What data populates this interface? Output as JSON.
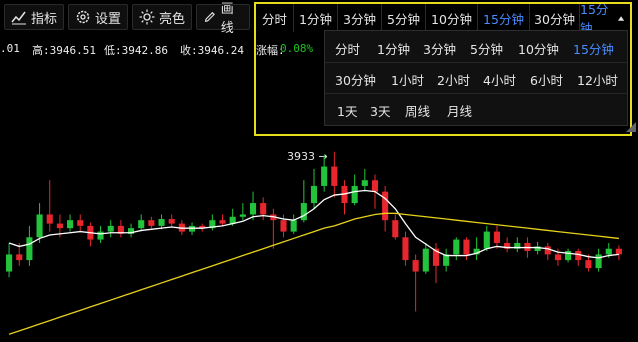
{
  "toolbar": {
    "buttons": [
      {
        "label": "指标",
        "icon": "chart-icon"
      },
      {
        "label": "设置",
        "icon": "gear-icon"
      },
      {
        "label": "亮色",
        "icon": "sun-icon"
      },
      {
        "label": "画线",
        "icon": "pencil-icon"
      }
    ]
  },
  "stats": {
    "prev_fragment": ".01",
    "high": "高:3946.51",
    "low": "低:3942.86",
    "close": "收:3946.24",
    "change_label": "涨幅:",
    "change_value": "0.08%"
  },
  "period_bar": {
    "tabs": [
      "分时",
      "1分钟",
      "3分钟",
      "5分钟",
      "10分钟",
      "15分钟",
      "30分钟"
    ],
    "active": "15分钟",
    "dropdown_label": "15分钟"
  },
  "period_panel": {
    "rows": [
      [
        "分时",
        "1分钟",
        "3分钟",
        "5分钟",
        "10分钟",
        "15分钟"
      ],
      [
        "30分钟",
        "1小时",
        "2小时",
        "4小时",
        "6小时",
        "12小时"
      ],
      [
        "1天",
        "3天",
        "周线",
        "月线"
      ]
    ],
    "active": "15分钟"
  },
  "chart": {
    "price_marker": "3933 →",
    "up_color": "#23c43c",
    "down_color": "#e8262e",
    "ma_fast_color": "#ffffff",
    "ma_slow_color": "#e6d21a"
  },
  "chart_data": {
    "type": "candlestick",
    "candles": [
      [
        3926,
        3927.5,
        3925.5,
        3928.5
      ],
      [
        3927.5,
        3927,
        3926.5,
        3928.5
      ],
      [
        3927,
        3929,
        3926.5,
        3930
      ],
      [
        3929,
        3931,
        3928.5,
        3932
      ],
      [
        3931,
        3930.2,
        3929.5,
        3934
      ],
      [
        3930.2,
        3929.8,
        3929,
        3931
      ],
      [
        3929.8,
        3930.5,
        3929.5,
        3931
      ],
      [
        3930.5,
        3930,
        3929.5,
        3931
      ],
      [
        3930,
        3928.8,
        3928.2,
        3930.3
      ],
      [
        3928.8,
        3929.5,
        3928.5,
        3930
      ],
      [
        3929.5,
        3930,
        3929,
        3930.5
      ],
      [
        3930,
        3929.3,
        3929,
        3930.5
      ],
      [
        3929.3,
        3929.8,
        3929,
        3930.2
      ],
      [
        3929.8,
        3930.5,
        3929.5,
        3931
      ],
      [
        3930.5,
        3930,
        3929.8,
        3930.8
      ],
      [
        3930,
        3930.6,
        3929.7,
        3931
      ],
      [
        3930.6,
        3930.2,
        3929.9,
        3931
      ],
      [
        3930.2,
        3929.5,
        3929.2,
        3930.5
      ],
      [
        3929.5,
        3930,
        3929.2,
        3930.3
      ],
      [
        3930,
        3929.8,
        3929.5,
        3930.2
      ],
      [
        3929.8,
        3930.5,
        3929.6,
        3931
      ],
      [
        3930.5,
        3930.2,
        3930,
        3931
      ],
      [
        3930.2,
        3930.8,
        3930,
        3931.5
      ],
      [
        3930.8,
        3931,
        3930.5,
        3932
      ],
      [
        3931,
        3932,
        3930.5,
        3933
      ],
      [
        3932,
        3931,
        3930.5,
        3932.5
      ],
      [
        3931,
        3930.5,
        3928,
        3931.5
      ],
      [
        3930.5,
        3929.5,
        3929,
        3931
      ],
      [
        3929.5,
        3930.5,
        3929.3,
        3931
      ],
      [
        3930.5,
        3932,
        3930.3,
        3934
      ],
      [
        3932,
        3933.5,
        3931.5,
        3935
      ],
      [
        3933.5,
        3935.2,
        3933,
        3936.2
      ],
      [
        3935.2,
        3933.5,
        3932.5,
        3936.5
      ],
      [
        3933.5,
        3932,
        3931,
        3934
      ],
      [
        3932,
        3933.5,
        3931.8,
        3934.5
      ],
      [
        3933.5,
        3934,
        3933,
        3935
      ],
      [
        3934,
        3933,
        3931.5,
        3934.5
      ],
      [
        3933,
        3930.5,
        3929.5,
        3933.5
      ],
      [
        3930.5,
        3929,
        3928.8,
        3931
      ],
      [
        3929,
        3927,
        3926.5,
        3929.5
      ],
      [
        3927,
        3926,
        3922.5,
        3927.5
      ],
      [
        3926,
        3928,
        3925.8,
        3928.5
      ],
      [
        3928,
        3926.5,
        3925,
        3928.5
      ],
      [
        3926.5,
        3927.5,
        3926,
        3928
      ],
      [
        3927.5,
        3928.8,
        3927,
        3929
      ],
      [
        3928.8,
        3927.5,
        3927,
        3929
      ],
      [
        3927.5,
        3928,
        3927,
        3929
      ],
      [
        3928,
        3929.5,
        3927.8,
        3930
      ],
      [
        3929.5,
        3928.5,
        3928,
        3930
      ],
      [
        3928.5,
        3928,
        3927.7,
        3929
      ],
      [
        3928,
        3928.5,
        3927.7,
        3929
      ],
      [
        3928.5,
        3927.8,
        3927.2,
        3929
      ],
      [
        3927.8,
        3928.2,
        3927.5,
        3928.6
      ],
      [
        3928.2,
        3927.5,
        3927,
        3928.5
      ],
      [
        3927.5,
        3927,
        3926.5,
        3928
      ],
      [
        3927,
        3927.8,
        3926.8,
        3928
      ],
      [
        3927.8,
        3927,
        3926.5,
        3928
      ],
      [
        3927,
        3926.3,
        3926,
        3927.5
      ],
      [
        3926.3,
        3927.5,
        3926,
        3928
      ],
      [
        3927.5,
        3928,
        3927.2,
        3928.5
      ],
      [
        3928,
        3927.5,
        3927,
        3928.3
      ]
    ],
    "series": [
      {
        "values": [
          3928.5,
          3928.2,
          3928.4,
          3928.9,
          3929.2,
          3929.3,
          3929.4,
          3929.5,
          3929.4,
          3929.3,
          3929.4,
          3929.4,
          3929.4,
          3929.6,
          3929.7,
          3929.8,
          3929.9,
          3929.8,
          3929.8,
          3929.8,
          3929.9,
          3930,
          3930.2,
          3930.4,
          3930.8,
          3930.9,
          3930.8,
          3930.6,
          3930.5,
          3930.9,
          3931.5,
          3932.3,
          3932.7,
          3932.8,
          3933,
          3933.1,
          3933,
          3932.4,
          3931.5,
          3930.2,
          3929,
          3928.4,
          3927.8,
          3927.4,
          3927.4,
          3927.4,
          3927.6,
          3928,
          3928.2,
          3928.1,
          3928.1,
          3928.1,
          3928.1,
          3928,
          3927.7,
          3927.6,
          3927.5,
          3927.3,
          3927.2,
          3927.4,
          3927.5
        ]
      },
      {
        "values": [
          3920.5,
          3920.8,
          3921.1,
          3921.4,
          3921.7,
          3922,
          3922.3,
          3922.6,
          3922.9,
          3923.2,
          3923.5,
          3923.8,
          3924.1,
          3924.4,
          3924.7,
          3925,
          3925.3,
          3925.6,
          3925.9,
          3926.2,
          3926.5,
          3926.8,
          3927.1,
          3927.4,
          3927.7,
          3928,
          3928.3,
          3928.6,
          3928.9,
          3929.2,
          3929.5,
          3929.8,
          3930,
          3930.3,
          3930.6,
          3930.8,
          3931,
          3931.1,
          3931.1,
          3931,
          3930.9,
          3930.8,
          3930.7,
          3930.6,
          3930.5,
          3930.4,
          3930.3,
          3930.2,
          3930.1,
          3930,
          3929.9,
          3929.8,
          3929.7,
          3929.6,
          3929.5,
          3929.4,
          3929.3,
          3929.2,
          3929.1,
          3929,
          3928.9
        ]
      }
    ],
    "candle_format": "[open, close, low, high]",
    "ylim": [
      3920,
      3937
    ]
  }
}
